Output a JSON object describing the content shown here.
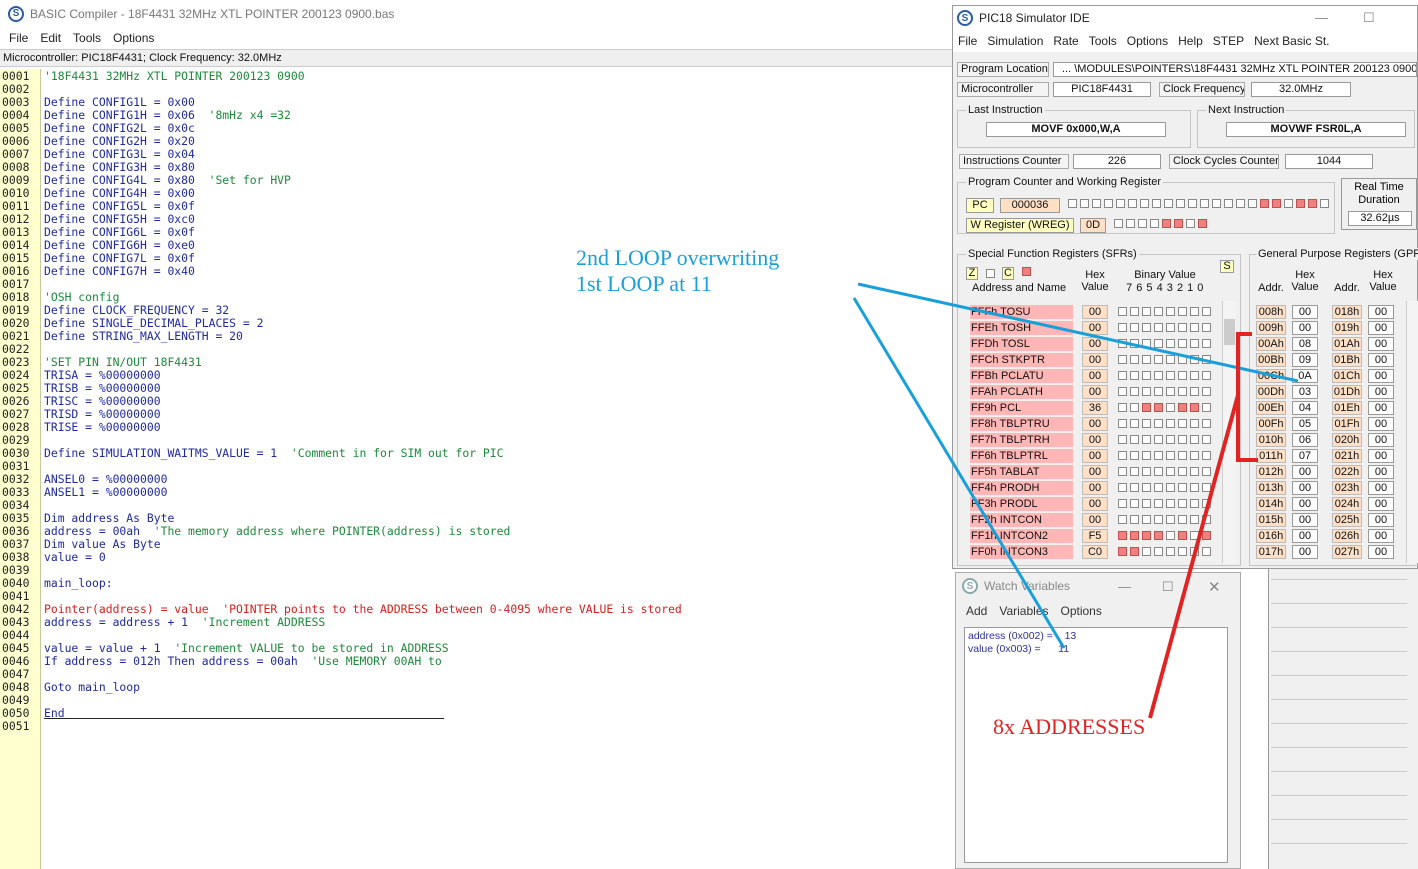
{
  "compiler": {
    "title": "BASIC Compiler - 18F4431 32MHz XTL POINTER 200123 0900.bas",
    "menu": [
      "File",
      "Edit",
      "Tools",
      "Options"
    ],
    "info": "Microcontroller: PIC18F4431;  Clock Frequency: 32.0MHz",
    "lines": [
      {
        "n": "0001",
        "parts": [
          {
            "t": "'18F4431 32MHz XTL POINTER 200123 0900",
            "c": "c-com"
          }
        ]
      },
      {
        "n": "0002",
        "parts": []
      },
      {
        "n": "0003",
        "parts": [
          {
            "t": "Define CONFIG1L = 0x00",
            "c": "c-def"
          }
        ]
      },
      {
        "n": "0004",
        "parts": [
          {
            "t": "Define CONFIG1H = 0x06  ",
            "c": "c-def"
          },
          {
            "t": "'8mHz x4 =32",
            "c": "c-com"
          }
        ]
      },
      {
        "n": "0005",
        "parts": [
          {
            "t": "Define CONFIG2L = 0x0c",
            "c": "c-def"
          }
        ]
      },
      {
        "n": "0006",
        "parts": [
          {
            "t": "Define CONFIG2H = 0x20",
            "c": "c-def"
          }
        ]
      },
      {
        "n": "0007",
        "parts": [
          {
            "t": "Define CONFIG3L = 0x04",
            "c": "c-def"
          }
        ]
      },
      {
        "n": "0008",
        "parts": [
          {
            "t": "Define CONFIG3H = 0x80",
            "c": "c-def"
          }
        ]
      },
      {
        "n": "0009",
        "parts": [
          {
            "t": "Define CONFIG4L = 0x80  ",
            "c": "c-def"
          },
          {
            "t": "'Set for HVP",
            "c": "c-com"
          }
        ]
      },
      {
        "n": "0010",
        "parts": [
          {
            "t": "Define CONFIG4H = 0x00",
            "c": "c-def"
          }
        ]
      },
      {
        "n": "0011",
        "parts": [
          {
            "t": "Define CONFIG5L = 0x0f",
            "c": "c-def"
          }
        ]
      },
      {
        "n": "0012",
        "parts": [
          {
            "t": "Define CONFIG5H = 0xc0",
            "c": "c-def"
          }
        ]
      },
      {
        "n": "0013",
        "parts": [
          {
            "t": "Define CONFIG6L = 0x0f",
            "c": "c-def"
          }
        ]
      },
      {
        "n": "0014",
        "parts": [
          {
            "t": "Define CONFIG6H = 0xe0",
            "c": "c-def"
          }
        ]
      },
      {
        "n": "0015",
        "parts": [
          {
            "t": "Define CONFIG7L = 0x0f",
            "c": "c-def"
          }
        ]
      },
      {
        "n": "0016",
        "parts": [
          {
            "t": "Define CONFIG7H = 0x40",
            "c": "c-def"
          }
        ]
      },
      {
        "n": "0017",
        "parts": []
      },
      {
        "n": "0018",
        "parts": [
          {
            "t": "'OSH config",
            "c": "c-com"
          }
        ]
      },
      {
        "n": "0019",
        "parts": [
          {
            "t": "Define CLOCK_FREQUENCY = 32",
            "c": "c-def"
          }
        ]
      },
      {
        "n": "0020",
        "parts": [
          {
            "t": "Define SINGLE_DECIMAL_PLACES = 2",
            "c": "c-def"
          }
        ]
      },
      {
        "n": "0021",
        "parts": [
          {
            "t": "Define STRING_MAX_LENGTH = 20",
            "c": "c-def"
          }
        ]
      },
      {
        "n": "0022",
        "parts": []
      },
      {
        "n": "0023",
        "parts": [
          {
            "t": "'SET PIN IN/OUT 18F4431",
            "c": "c-com"
          }
        ]
      },
      {
        "n": "0024",
        "parts": [
          {
            "t": "TRISA = %00000000",
            "c": "c-def"
          }
        ]
      },
      {
        "n": "0025",
        "parts": [
          {
            "t": "TRISB = %00000000",
            "c": "c-def"
          }
        ]
      },
      {
        "n": "0026",
        "parts": [
          {
            "t": "TRISC = %00000000",
            "c": "c-def"
          }
        ]
      },
      {
        "n": "0027",
        "parts": [
          {
            "t": "TRISD = %00000000",
            "c": "c-def"
          }
        ]
      },
      {
        "n": "0028",
        "parts": [
          {
            "t": "TRISE = %00000000",
            "c": "c-def"
          }
        ]
      },
      {
        "n": "0029",
        "parts": []
      },
      {
        "n": "0030",
        "parts": [
          {
            "t": "Define SIMULATION_WAITMS_VALUE = 1  ",
            "c": "c-def"
          },
          {
            "t": "'Comment in for SIM out for PIC",
            "c": "c-com"
          }
        ]
      },
      {
        "n": "0031",
        "parts": []
      },
      {
        "n": "0032",
        "parts": [
          {
            "t": "ANSEL0 = %00000000",
            "c": "c-def"
          }
        ]
      },
      {
        "n": "0033",
        "parts": [
          {
            "t": "ANSEL1 = %00000000",
            "c": "c-def"
          }
        ]
      },
      {
        "n": "0034",
        "parts": []
      },
      {
        "n": "0035",
        "parts": [
          {
            "t": "Dim address As Byte",
            "c": "c-def"
          }
        ]
      },
      {
        "n": "0036",
        "parts": [
          {
            "t": "address = 00ah  ",
            "c": "c-def"
          },
          {
            "t": "'The memory address where POINTER(address) is stored",
            "c": "c-com"
          }
        ]
      },
      {
        "n": "0037",
        "parts": [
          {
            "t": "Dim value As Byte",
            "c": "c-def"
          }
        ]
      },
      {
        "n": "0038",
        "parts": [
          {
            "t": "value = 0",
            "c": "c-def"
          }
        ]
      },
      {
        "n": "0039",
        "parts": []
      },
      {
        "n": "0040",
        "parts": [
          {
            "t": "main_loop:",
            "c": "c-def"
          }
        ]
      },
      {
        "n": "0041",
        "parts": []
      },
      {
        "n": "0042",
        "parts": [
          {
            "t": "Pointer(address) = value  ",
            "c": "c-red"
          },
          {
            "t": "'POINTER points to the ADDRESS between 0-4095 where VALUE is stored",
            "c": "c-red"
          }
        ]
      },
      {
        "n": "0043",
        "parts": [
          {
            "t": "address = address + 1  ",
            "c": "c-def"
          },
          {
            "t": "'Increment ADDRESS",
            "c": "c-com"
          }
        ]
      },
      {
        "n": "0044",
        "parts": []
      },
      {
        "n": "0045",
        "parts": [
          {
            "t": "value = value + 1  ",
            "c": "c-def"
          },
          {
            "t": "'Increment VALUE to be stored in ADDRESS",
            "c": "c-com"
          }
        ]
      },
      {
        "n": "0046",
        "parts": [
          {
            "t": "If address = 012h Then address = 00ah  ",
            "c": "c-def"
          },
          {
            "t": "'Use MEMORY 00AH to",
            "c": "c-com"
          }
        ]
      },
      {
        "n": "0047",
        "parts": []
      },
      {
        "n": "0048",
        "parts": [
          {
            "t": "Goto main_loop",
            "c": "c-def"
          }
        ]
      },
      {
        "n": "0049",
        "parts": []
      },
      {
        "n": "0050",
        "parts": [
          {
            "t": "End",
            "c": "c-def"
          }
        ]
      },
      {
        "n": "0051",
        "parts": []
      }
    ]
  },
  "sim": {
    "title": "PIC18 Simulator IDE",
    "menu": [
      "File",
      "Simulation",
      "Rate",
      "Tools",
      "Options",
      "Help",
      "STEP",
      "Next Basic St."
    ],
    "program_location_label": "Program Location",
    "program_location": "... \\MODULES\\POINTERS\\18F4431 32MHz XTL POINTER 200123 0900.hex",
    "microcontroller_label": "Microcontroller",
    "microcontroller": "PIC18F4431",
    "clock_label": "Clock Frequency",
    "clock": "32.0MHz",
    "last_instr_label": "Last Instruction",
    "last_instr": "MOVF 0x000,W,A",
    "next_instr_label": "Next Instruction",
    "next_instr": "MOVWF FSR0L,A",
    "instr_counter_label": "Instructions Counter",
    "instr_counter": "226",
    "cycles_label": "Clock Cycles Counter",
    "cycles": "1044",
    "pcw_label": "Program Counter and Working Register",
    "pc_label": "PC",
    "pc": "000036",
    "pc_bits": [
      0,
      0,
      0,
      0,
      0,
      0,
      0,
      0,
      0,
      0,
      0,
      0,
      0,
      0,
      0,
      0,
      1,
      1,
      0,
      1,
      1,
      0
    ],
    "w_label": "W Register (WREG)",
    "w": "0D",
    "w_bits": [
      0,
      0,
      0,
      0,
      1,
      1,
      0,
      1
    ],
    "rt_label": "Real Time Duration",
    "rt": "32.62µs",
    "sfr_title": "Special Function Registers (SFRs)",
    "flags": [
      "Z",
      "C"
    ],
    "s_btn": "S",
    "sfr_head_name": "Address and Name",
    "sfr_head_hex": "Hex Value",
    "sfr_head_bin": "Binary Value",
    "sfr_head_bits": "7 6 5 4 3 2 1 0",
    "sfrs": [
      {
        "name": "FFFh  TOSU",
        "hex": "00",
        "bits": [
          0,
          0,
          0,
          0,
          0,
          0,
          0,
          0
        ]
      },
      {
        "name": "FFEh  TOSH",
        "hex": "00",
        "bits": [
          0,
          0,
          0,
          0,
          0,
          0,
          0,
          0
        ]
      },
      {
        "name": "FFDh  TOSL",
        "hex": "00",
        "bits": [
          0,
          0,
          0,
          0,
          0,
          0,
          0,
          0
        ]
      },
      {
        "name": "FFCh  STKPTR",
        "hex": "00",
        "bits": [
          0,
          0,
          0,
          0,
          0,
          0,
          0,
          0
        ]
      },
      {
        "name": "FFBh  PCLATU",
        "hex": "00",
        "bits": [
          0,
          0,
          0,
          0,
          0,
          0,
          0,
          0
        ]
      },
      {
        "name": "FFAh  PCLATH",
        "hex": "00",
        "bits": [
          0,
          0,
          0,
          0,
          0,
          0,
          0,
          0
        ]
      },
      {
        "name": "FF9h  PCL",
        "hex": "36",
        "bits": [
          0,
          0,
          1,
          1,
          0,
          1,
          1,
          0
        ]
      },
      {
        "name": "FF8h  TBLPTRU",
        "hex": "00",
        "bits": [
          0,
          0,
          0,
          0,
          0,
          0,
          0,
          0
        ]
      },
      {
        "name": "FF7h  TBLPTRH",
        "hex": "00",
        "bits": [
          0,
          0,
          0,
          0,
          0,
          0,
          0,
          0
        ]
      },
      {
        "name": "FF6h  TBLPTRL",
        "hex": "00",
        "bits": [
          0,
          0,
          0,
          0,
          0,
          0,
          0,
          0
        ]
      },
      {
        "name": "FF5h  TABLAT",
        "hex": "00",
        "bits": [
          0,
          0,
          0,
          0,
          0,
          0,
          0,
          0
        ]
      },
      {
        "name": "FF4h  PRODH",
        "hex": "00",
        "bits": [
          0,
          0,
          0,
          0,
          0,
          0,
          0,
          0
        ]
      },
      {
        "name": "FF3h  PRODL",
        "hex": "00",
        "bits": [
          0,
          0,
          0,
          0,
          0,
          0,
          0,
          0
        ]
      },
      {
        "name": "FF2h  INTCON",
        "hex": "00",
        "bits": [
          0,
          0,
          0,
          0,
          0,
          0,
          0,
          0
        ]
      },
      {
        "name": "FF1h  INTCON2",
        "hex": "F5",
        "bits": [
          1,
          1,
          1,
          1,
          0,
          1,
          0,
          1
        ]
      },
      {
        "name": "FF0h  INTCON3",
        "hex": "C0",
        "bits": [
          1,
          1,
          0,
          0,
          0,
          0,
          0,
          0
        ]
      }
    ],
    "gpr_title": "General Purpose Registers (GPRs)",
    "gpr_head_addr": "Addr.",
    "gpr_head_hex": "Hex Value",
    "gprs": [
      {
        "a1": "008h",
        "v1": "00",
        "a2": "018h",
        "v2": "00"
      },
      {
        "a1": "009h",
        "v1": "00",
        "a2": "019h",
        "v2": "00"
      },
      {
        "a1": "00Ah",
        "v1": "08",
        "a2": "01Ah",
        "v2": "00"
      },
      {
        "a1": "00Bh",
        "v1": "09",
        "a2": "01Bh",
        "v2": "00"
      },
      {
        "a1": "00Ch",
        "v1": "0A",
        "a2": "01Ch",
        "v2": "00"
      },
      {
        "a1": "00Dh",
        "v1": "03",
        "a2": "01Dh",
        "v2": "00"
      },
      {
        "a1": "00Eh",
        "v1": "04",
        "a2": "01Eh",
        "v2": "00"
      },
      {
        "a1": "00Fh",
        "v1": "05",
        "a2": "01Fh",
        "v2": "00"
      },
      {
        "a1": "010h",
        "v1": "06",
        "a2": "020h",
        "v2": "00"
      },
      {
        "a1": "011h",
        "v1": "07",
        "a2": "021h",
        "v2": "00"
      },
      {
        "a1": "012h",
        "v1": "00",
        "a2": "022h",
        "v2": "00"
      },
      {
        "a1": "013h",
        "v1": "00",
        "a2": "023h",
        "v2": "00"
      },
      {
        "a1": "014h",
        "v1": "00",
        "a2": "024h",
        "v2": "00"
      },
      {
        "a1": "015h",
        "v1": "00",
        "a2": "025h",
        "v2": "00"
      },
      {
        "a1": "016h",
        "v1": "00",
        "a2": "026h",
        "v2": "00"
      },
      {
        "a1": "017h",
        "v1": "00",
        "a2": "027h",
        "v2": "00"
      }
    ]
  },
  "watch": {
    "title": "Watch Variables",
    "menu": [
      "Add",
      "Variables",
      "Options"
    ],
    "items": [
      "address (0x002) =    13",
      "value (0x003) =      11"
    ]
  },
  "annotations": {
    "blue": "2nd LOOP overwriting\n1st LOOP at 11",
    "red": "8x ADDRESSES",
    "blue_color": "#1aa0d8",
    "red_color": "#e02424"
  }
}
